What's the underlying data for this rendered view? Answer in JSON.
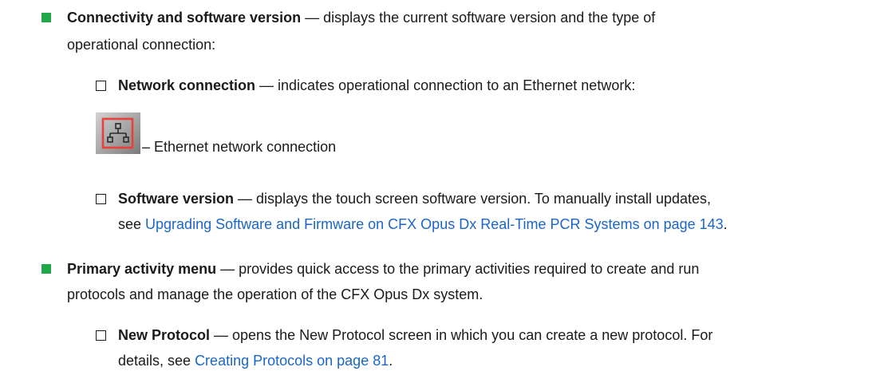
{
  "items": [
    {
      "title": "Connectivity and software version",
      "desc_line1": " — displays the current software version and the type of",
      "desc_line2": "operational connection:",
      "subitems": [
        {
          "title": "Network connection",
          "desc": " — indicates operational connection to an Ethernet network:",
          "icon_name": "ethernet-network-icon",
          "icon_caption": "– Ethernet network connection"
        },
        {
          "title": "Software version",
          "desc_line1": " — displays the touch screen software version. To manually install updates,",
          "line2_prefix": "see ",
          "link_text": "Upgrading Software and Firmware on CFX Opus Dx Real-Time PCR Systems on page 143",
          "line2_suffix": "."
        }
      ]
    },
    {
      "title": "Primary activity menu",
      "desc_line1": " — provides quick access to the primary activities required to create and run",
      "desc_line2": "protocols and manage the operation of the CFX Opus Dx system.",
      "subitems": [
        {
          "title": "New Protocol",
          "desc_line1": " — opens the New Protocol screen in which you can create a new protocol. For",
          "line2_prefix": "details, see ",
          "link_text": "Creating Protocols on page 81",
          "line2_suffix": "."
        }
      ]
    }
  ],
  "colors": {
    "bullet_green": "#1fa84a",
    "link_blue": "#1a66c8",
    "icon_red": "#e8403a",
    "icon_bg": "#9a9a9a"
  }
}
